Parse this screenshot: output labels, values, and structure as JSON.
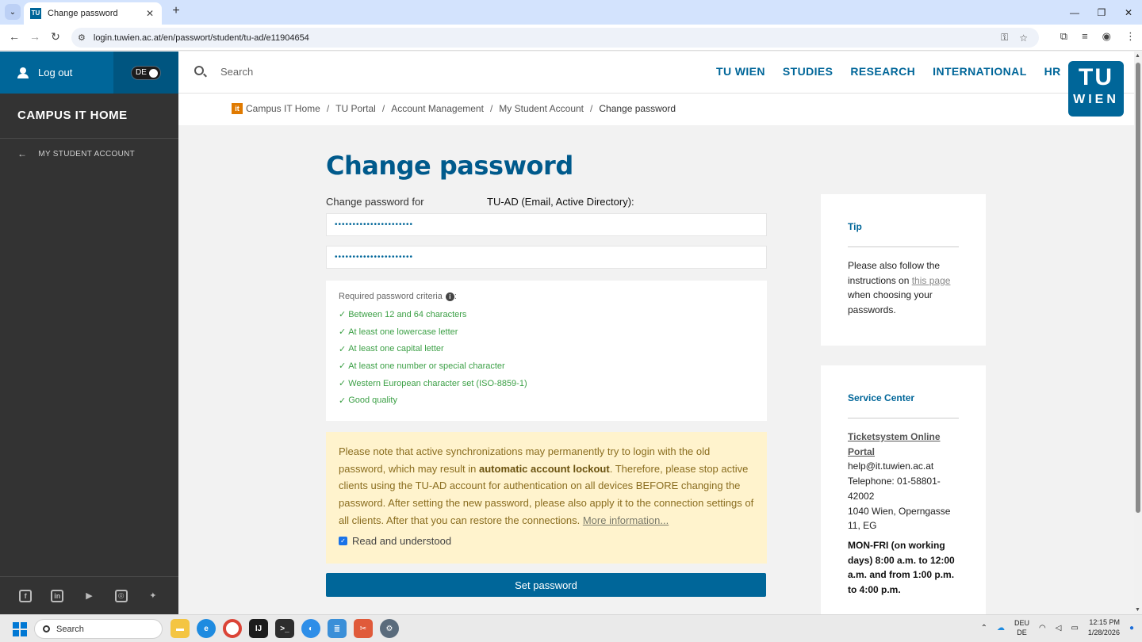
{
  "browser": {
    "tab_title": "Change password",
    "tab_favicon_text": "TU",
    "url": "login.tuwien.ac.at/en/passwort/student/tu-ad/e11904654"
  },
  "sidebar": {
    "logout_label": "Log out",
    "lang_label": "DE",
    "title": "CAMPUS IT HOME",
    "back_item": "MY STUDENT ACCOUNT",
    "social": [
      "facebook-icon",
      "linkedin-icon",
      "youtube-icon",
      "instagram-icon",
      "bluesky-icon"
    ]
  },
  "topnav": {
    "search_placeholder": "Search",
    "items": [
      "TU WIEN",
      "STUDIES",
      "RESEARCH",
      "INTERNATIONAL",
      "HR"
    ],
    "logo_top": "TU",
    "logo_bottom": "WIEN"
  },
  "breadcrumb": {
    "badge": "it",
    "items": [
      "Campus IT Home",
      "TU Portal",
      "Account Management",
      "My Student Account",
      "Change password"
    ],
    "separator": "/"
  },
  "main": {
    "title": "Change password",
    "change_for_label": "Change password for",
    "account_label": "TU-AD (Email, Active Directory):",
    "password_mask": "••••••••••••••••••••••",
    "password_confirm_mask": "••••••••••••••••••••••",
    "criteria_head": "Required password criteria",
    "criteria_colon": ":",
    "criteria": [
      "Between 12 and 64 characters",
      "At least one lowercase letter",
      "At least one capital letter",
      "At least one number or special character",
      "Western European character set (ISO-8859-1)",
      "Good quality"
    ],
    "warning_pre": "Please note that active synchronizations may permanently try to login with the old password, which may result in ",
    "warning_bold": "automatic account lockout",
    "warning_post": ". Therefore, please stop active clients using the TU-AD account for authentication on all devices BEFORE changing the password. After setting the new password, please also apply it to the connection settings of all clients. After that you can restore the connections. ",
    "warning_link": "More information...",
    "checkbox_label": "Read and understood",
    "submit_label": "Set password"
  },
  "tip": {
    "title": "Tip",
    "text_pre": "Please also follow the instructions on ",
    "link": "this page",
    "text_post": " when choosing your passwords."
  },
  "service": {
    "title": "Service Center",
    "ticket_link": "Ticketsystem Online Portal",
    "email": "help@it.tuwien.ac.at",
    "phone": "Telephone: 01-58801-42002",
    "address": "1040 Wien, Operngasse 11, EG",
    "hours": "MON-FRI (on working days) 8:00 a.m. to 12:00 a.m. and from 1:00 p.m. to 4:00 p.m."
  },
  "taskbar": {
    "search_label": "Search",
    "lang_top": "DEU",
    "lang_bottom": "DE",
    "time": "12:15 PM",
    "date": "1/28/2026"
  }
}
